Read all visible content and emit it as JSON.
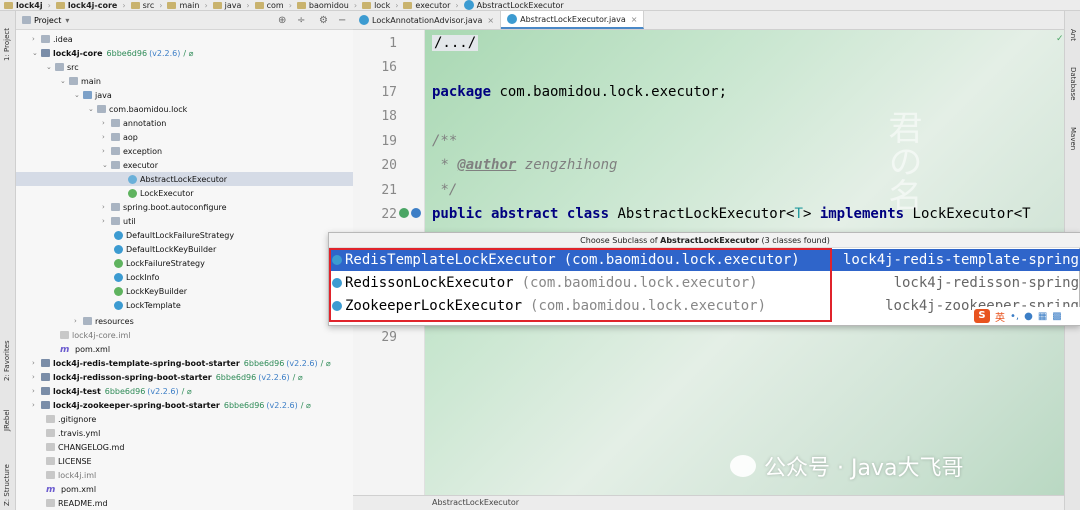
{
  "breadcrumb": [
    "lock4j",
    "lock4j-core",
    "src",
    "main",
    "java",
    "com",
    "baomidou",
    "lock",
    "executor",
    "AbstractLockExecutor"
  ],
  "side_left": {
    "project": "1: Project",
    "favorites": "2: Favorites",
    "jrebel": "JRebel",
    "structure": "Z: Structure"
  },
  "side_right": {
    "ant": "Ant",
    "database": "Database",
    "maven": "Maven"
  },
  "project_header": {
    "title": "Project"
  },
  "tree": [
    {
      "label": ".idea",
      "extra": "",
      "ver": "",
      "post": ""
    },
    {
      "label": "lock4j-core",
      "extra": "6bbe6d96",
      "ver": "(v2.2.6)",
      "post": "/ ⌀"
    },
    {
      "label": "src",
      "extra": "",
      "ver": "",
      "post": ""
    },
    {
      "label": "main",
      "extra": "",
      "ver": "",
      "post": ""
    },
    {
      "label": "java",
      "extra": "",
      "ver": "",
      "post": ""
    },
    {
      "label": "com.baomidou.lock",
      "extra": "",
      "ver": "",
      "post": ""
    },
    {
      "label": "annotation",
      "extra": "",
      "ver": "",
      "post": ""
    },
    {
      "label": "aop",
      "extra": "",
      "ver": "",
      "post": ""
    },
    {
      "label": "exception",
      "extra": "",
      "ver": "",
      "post": ""
    },
    {
      "label": "executor",
      "extra": "",
      "ver": "",
      "post": ""
    },
    {
      "label": "AbstractLockExecutor",
      "extra": "",
      "ver": "",
      "post": ""
    },
    {
      "label": "LockExecutor",
      "extra": "",
      "ver": "",
      "post": ""
    },
    {
      "label": "spring.boot.autoconfigure",
      "extra": "",
      "ver": "",
      "post": ""
    },
    {
      "label": "util",
      "extra": "",
      "ver": "",
      "post": ""
    },
    {
      "label": "DefaultLockFailureStrategy",
      "extra": "",
      "ver": "",
      "post": ""
    },
    {
      "label": "DefaultLockKeyBuilder",
      "extra": "",
      "ver": "",
      "post": ""
    },
    {
      "label": "LockFailureStrategy",
      "extra": "",
      "ver": "",
      "post": ""
    },
    {
      "label": "LockInfo",
      "extra": "",
      "ver": "",
      "post": ""
    },
    {
      "label": "LockKeyBuilder",
      "extra": "",
      "ver": "",
      "post": ""
    },
    {
      "label": "LockTemplate",
      "extra": "",
      "ver": "",
      "post": ""
    },
    {
      "label": "resources",
      "extra": "",
      "ver": "",
      "post": ""
    },
    {
      "label": "lock4j-core.iml",
      "extra": "",
      "ver": "",
      "post": ""
    },
    {
      "label": "pom.xml",
      "extra": "",
      "ver": "",
      "post": ""
    },
    {
      "label": "lock4j-redis-template-spring-boot-starter",
      "extra": "6bbe6d96",
      "ver": "(v2.2.6)",
      "post": "/ ⌀"
    },
    {
      "label": "lock4j-redisson-spring-boot-starter",
      "extra": "6bbe6d96",
      "ver": "(v2.2.6)",
      "post": "/ ⌀"
    },
    {
      "label": "lock4j-test",
      "extra": "6bbe6d96",
      "ver": "(v2.2.6)",
      "post": "/ ⌀"
    },
    {
      "label": "lock4j-zookeeper-spring-boot-starter",
      "extra": "6bbe6d96",
      "ver": "(v2.2.6)",
      "post": "/ ⌀"
    },
    {
      "label": ".gitignore",
      "extra": "",
      "ver": "",
      "post": ""
    },
    {
      "label": ".travis.yml",
      "extra": "",
      "ver": "",
      "post": ""
    },
    {
      "label": "CHANGELOG.md",
      "extra": "",
      "ver": "",
      "post": ""
    },
    {
      "label": "LICENSE",
      "extra": "",
      "ver": "",
      "post": ""
    },
    {
      "label": "lock4j.iml",
      "extra": "",
      "ver": "",
      "post": ""
    },
    {
      "label": "pom.xml",
      "extra": "",
      "ver": "",
      "post": ""
    },
    {
      "label": "README.md",
      "extra": "",
      "ver": "",
      "post": ""
    }
  ],
  "tabs": [
    {
      "label": "LockAnnotationAdvisor.java"
    },
    {
      "label": "AbstractLockExecutor.java"
    }
  ],
  "editor": {
    "lines": [
      "1",
      "16",
      "17",
      "18",
      "19",
      "20",
      "21",
      "22",
      "29"
    ],
    "fold": "/.../",
    "pkg_kw": "package",
    "pkg_name": "com.baomidou.lock.executor;",
    "doc_open": "/**",
    "doc_star": "*",
    "author_tag": "@author",
    "author_name": "zengzhihong",
    "doc_close": "*/",
    "decl_kw1": "public",
    "decl_kw2": "abstract",
    "decl_kw3": "class",
    "decl_name": "AbstractLockExecutor<",
    "decl_t": "T",
    "decl_mid": ">",
    "decl_kw4": "implements",
    "decl_tail": "LockExecutor<T"
  },
  "popup": {
    "title_pre": "Choose Subclass of ",
    "title_cls": "AbstractLockExecutor",
    "title_post": " (3 classes found)",
    "items": [
      {
        "name": "RedisTemplateLockExecutor",
        "pkg": "(com.baomidou.lock.executor)",
        "module": "lock4j-redis-template-spring"
      },
      {
        "name": "RedissonLockExecutor",
        "pkg": "(com.baomidou.lock.executor)",
        "module": "lock4j-redisson-spring"
      },
      {
        "name": "ZookeeperLockExecutor",
        "pkg": "(com.baomidou.lock.executor)",
        "module": "lock4j-zookeeper-spring"
      }
    ]
  },
  "ime": {
    "logo": "S",
    "lang": "英"
  },
  "status": {
    "text": "AbstractLockExecutor"
  },
  "watermark": {
    "text": "公众号 · Java大飞哥"
  },
  "background_text": "君の名"
}
